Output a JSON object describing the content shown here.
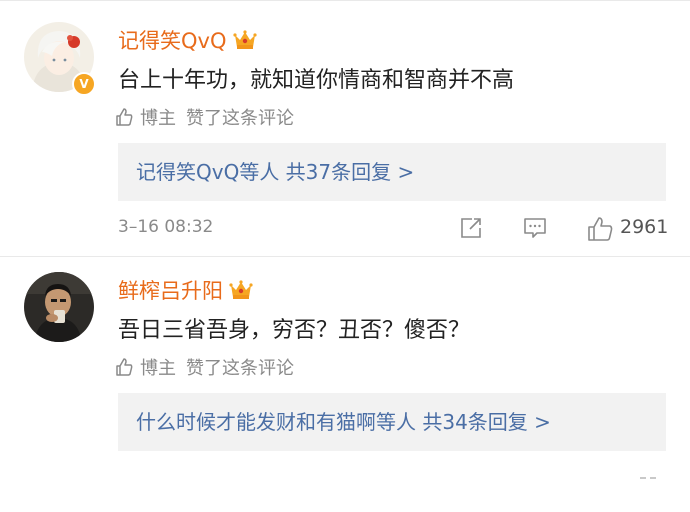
{
  "comments": [
    {
      "username": "记得笑QvQ",
      "text": "台上十年功，就知道你情商和智商并不高",
      "author_label": "博主",
      "liked_label": "赞了这条评论",
      "reply_text": "记得笑QvQ等人 共37条回复 >",
      "timestamp": "3–16 08:32",
      "likes": "2961",
      "verified": "V"
    },
    {
      "username": "鲜榨吕升阳",
      "text": "吾日三省吾身，穷否？丑否？傻否？",
      "author_label": "博主",
      "liked_label": "赞了这条评论",
      "reply_text": "什么时候才能发财和有猫啊等人 共34条回复 >"
    }
  ],
  "colors": {
    "username": "#e86b1b",
    "reply_link": "#4a6ea5",
    "meta_gray": "#8a8a8a",
    "crown": "#f6a623"
  }
}
